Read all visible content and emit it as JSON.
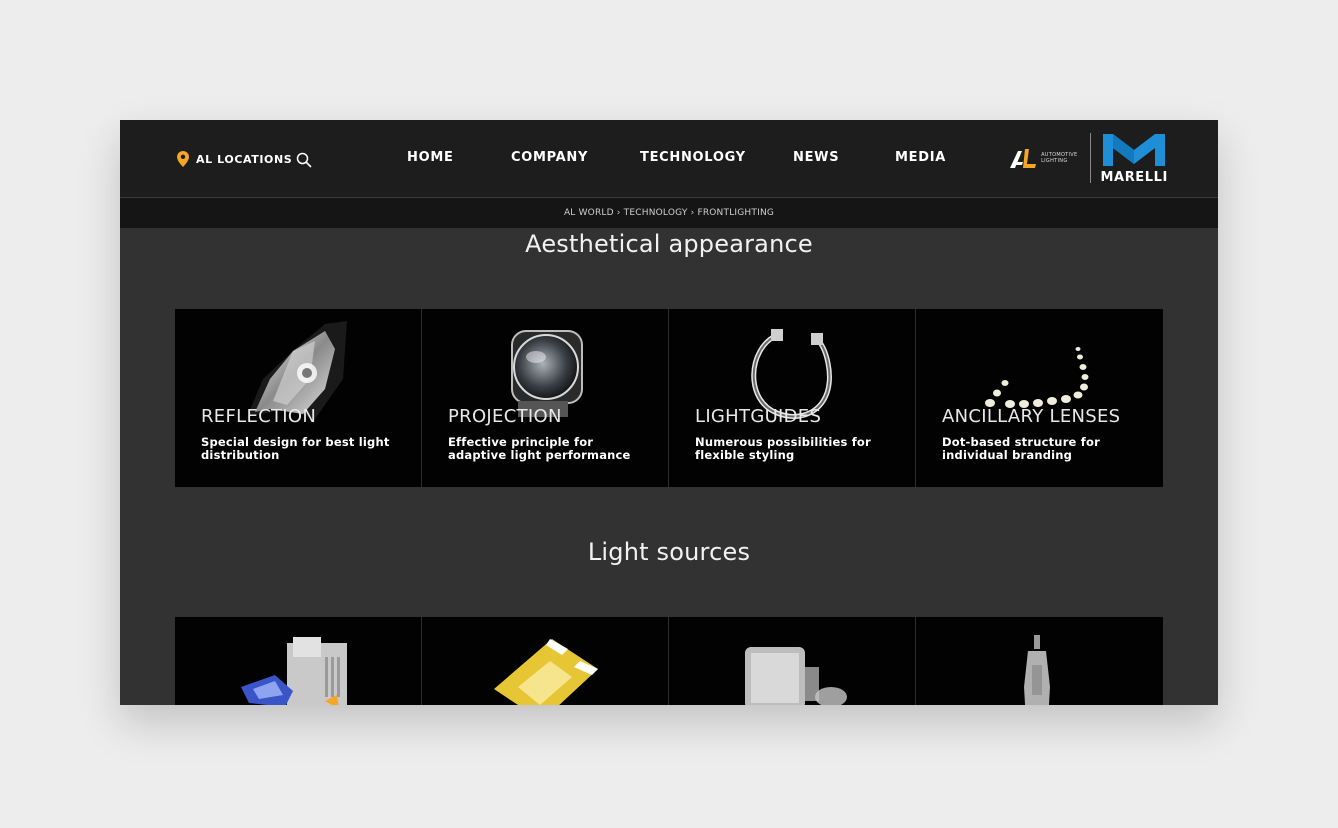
{
  "header": {
    "location_label": "AL LOCATIONS",
    "nav": [
      {
        "label": "HOME"
      },
      {
        "label": "COMPANY"
      },
      {
        "label": "TECHNOLOGY"
      },
      {
        "label": "NEWS"
      },
      {
        "label": "MEDIA"
      }
    ],
    "logo_al_lines": [
      "AUTOMOTIVE",
      "LIGHTING"
    ],
    "logo_marelli": "MARELLI"
  },
  "breadcrumb": "AL WORLD › TECHNOLOGY › FRONTLIGHTING",
  "sections": [
    {
      "title": "Aesthetical appearance",
      "cards": [
        {
          "title": "REFLECTION",
          "description": "Special design for best light distribution",
          "image": "reflector-headlamp-image"
        },
        {
          "title": "PROJECTION",
          "description": "Effective principle for adaptive light performance",
          "image": "projector-lens-image"
        },
        {
          "title": "LIGHTGUIDES",
          "description": "Numerous possibilities for flexible styling",
          "image": "lightguide-ring-image"
        },
        {
          "title": "ANCILLARY LENSES",
          "description": "Dot-based structure for individual branding",
          "image": "led-dots-image"
        }
      ]
    },
    {
      "title": "Light sources",
      "cards": [
        {
          "image": "laser-module-image"
        },
        {
          "image": "led-chip-image"
        },
        {
          "image": "xenon-bulb-image"
        },
        {
          "image": "halogen-bulb-image"
        }
      ]
    }
  ],
  "colors": {
    "accent_orange": "#f5a623",
    "marelli_blue": "#1e8fd6",
    "page_bg": "#313231",
    "header_bg": "#1d1d1d"
  }
}
